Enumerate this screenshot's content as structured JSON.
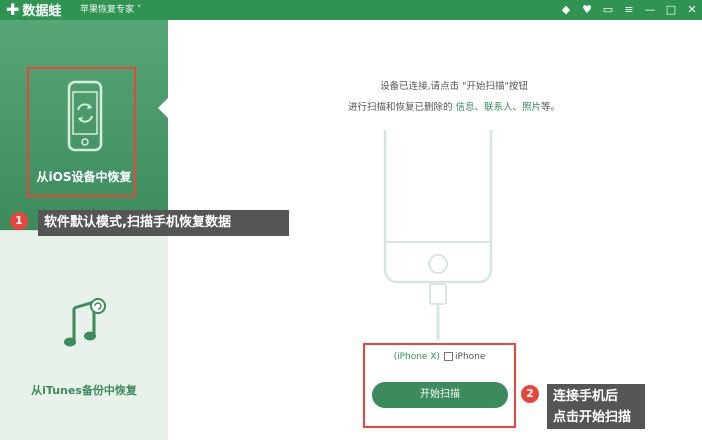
{
  "titlebar": {
    "app_name": "数据蛙",
    "subtitle": "苹果恢复专家 ˅",
    "controls": {
      "diamond": "◆",
      "shirt": "♥",
      "feedback": "▭",
      "menu": "≡",
      "minimize": "—",
      "maximize": "□",
      "close": "✕"
    }
  },
  "sidebar": {
    "items": [
      {
        "label": "从iOS设备中恢复",
        "icon": "phone-restore-icon",
        "selected": true
      },
      {
        "label": "从iTunes备份中恢复",
        "icon": "itunes-note-icon",
        "selected": false
      }
    ]
  },
  "main": {
    "instruction_line1": "设备已连接,请点击 \"开始扫描\"按钮",
    "instruction_prefix": "进行扫描和恢复已删除的 ",
    "types": [
      "信息",
      "联系人",
      "照片"
    ],
    "separator": "、",
    "instruction_suffix": "等。",
    "device_model": "(iPhone X)",
    "device_name": "iPhone",
    "scan_button": "开始扫描"
  },
  "annotations": {
    "badge1": "1",
    "callout1": "软件默认模式,扫描手机恢复数据",
    "badge2": "2",
    "callout2_line1": "连接手机后",
    "callout2_line2": "点击开始扫描"
  },
  "colors": {
    "brand_green": "#2f9352",
    "annotation_red": "#e8463b",
    "callout_gray": "#555555"
  }
}
